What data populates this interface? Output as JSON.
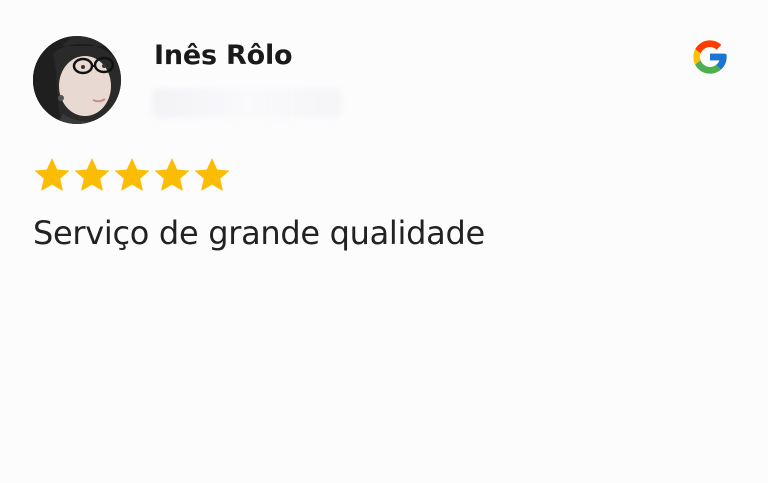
{
  "review": {
    "reviewer_name": "Inês Rôlo",
    "review_date": "",
    "rating": 5,
    "rating_max": 5,
    "text": "Serviço de grande qualidade",
    "source_icon": "google-g-icon",
    "avatar_icon": "user-avatar-photo"
  },
  "colors": {
    "star": "#FBBC04",
    "google_blue": "#4285F4",
    "google_red": "#EA4335",
    "google_yellow": "#FBBC05",
    "google_green": "#34A853",
    "text": "#222222"
  }
}
